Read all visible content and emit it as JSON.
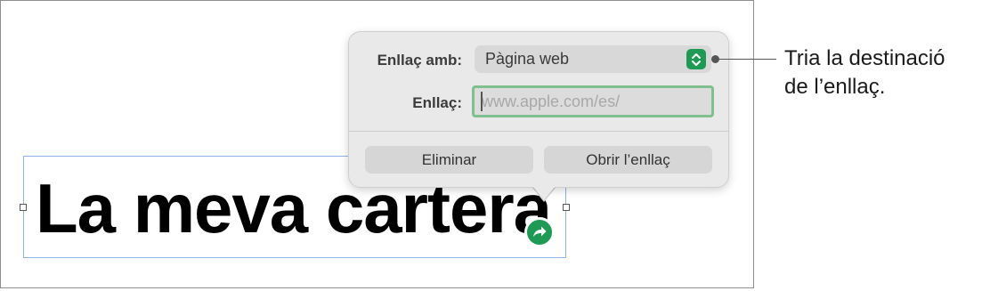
{
  "document": {
    "text": "La meva cartera"
  },
  "popover": {
    "link_with_label": "Enllaç amb:",
    "link_with_value": "Pàgina web",
    "link_label": "Enllaç:",
    "link_placeholder": "www.apple.com/es/",
    "remove_button": "Eliminar",
    "open_link_button": "Obrir l’enllaç"
  },
  "callout": {
    "line1": "Tria la destinació",
    "line2": "de l’enllaç."
  },
  "colors": {
    "accent_green": "#1f9a54",
    "popover_bg": "#e9e9e9",
    "selection_blue": "#8fb0e8"
  },
  "icons": {
    "link_badge": "arrow-forward-icon",
    "select_arrows": "chevron-up-down-icon"
  }
}
